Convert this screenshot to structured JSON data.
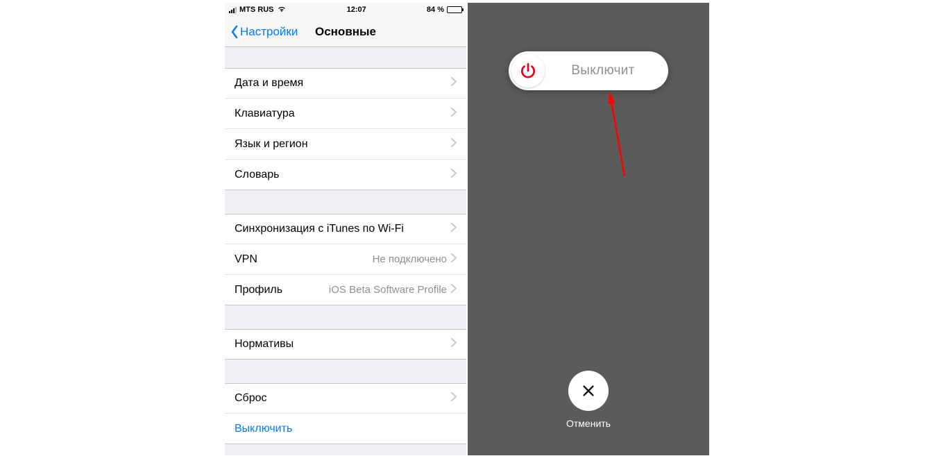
{
  "status": {
    "carrier": "MTS RUS",
    "time": "12:07",
    "battery_pct": "84 %"
  },
  "nav": {
    "back_label": "Настройки",
    "title": "Основные"
  },
  "groups": {
    "general": {
      "date_time": "Дата и время",
      "keyboard": "Клавиатура",
      "lang_region": "Язык и регион",
      "dictionary": "Словарь"
    },
    "network": {
      "itunes_wifi": "Синхронизация с iTunes по Wi-Fi",
      "vpn_label": "VPN",
      "vpn_value": "Не подключено",
      "profile_label": "Профиль",
      "profile_value": "iOS Beta Software Profile"
    },
    "legal": {
      "regulatory": "Нормативы"
    },
    "reset": {
      "reset": "Сброс",
      "shutdown": "Выключить"
    }
  },
  "poweroff": {
    "slider_text": "Выключит",
    "cancel_label": "Отменить"
  },
  "colors": {
    "ios_blue": "#007aff",
    "power_red": "#e3001b",
    "annot_red": "#ff0000"
  }
}
